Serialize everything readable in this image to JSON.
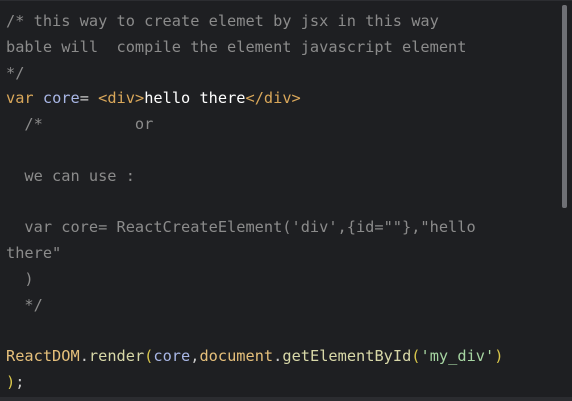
{
  "lines": [
    {
      "segments": [
        {
          "cls": "c-comment",
          "text": "/* this way to create elemet by jsx in this way"
        }
      ]
    },
    {
      "segments": [
        {
          "cls": "c-comment",
          "text": "bable will  compile the element javascript element"
        }
      ]
    },
    {
      "segments": [
        {
          "cls": "c-comment",
          "text": "*/"
        }
      ]
    },
    {
      "segments": [
        {
          "cls": "c-kw",
          "text": "var"
        },
        {
          "cls": "c-plain",
          "text": " "
        },
        {
          "cls": "c-var",
          "text": "core"
        },
        {
          "cls": "c-plain",
          "text": "= "
        },
        {
          "cls": "c-tag",
          "text": "<div>"
        },
        {
          "cls": "c-text",
          "text": "hello there"
        },
        {
          "cls": "c-tag",
          "text": "</div>"
        }
      ]
    },
    {
      "segments": [
        {
          "cls": "c-comment",
          "text": "  /*          or"
        }
      ]
    },
    {
      "segments": [
        {
          "cls": "c-comment",
          "text": ""
        }
      ]
    },
    {
      "segments": [
        {
          "cls": "c-comment",
          "text": "  we can use :"
        }
      ]
    },
    {
      "segments": [
        {
          "cls": "c-comment",
          "text": ""
        }
      ]
    },
    {
      "segments": [
        {
          "cls": "c-comment",
          "text": "  var core= ReactCreateElement('div',{id=\"\"},\"hello"
        }
      ]
    },
    {
      "segments": [
        {
          "cls": "c-comment",
          "text": "there\""
        }
      ]
    },
    {
      "segments": [
        {
          "cls": "c-comment",
          "text": "  )"
        }
      ]
    },
    {
      "segments": [
        {
          "cls": "c-comment",
          "text": "  */"
        }
      ]
    },
    {
      "segments": [
        {
          "cls": "c-plain",
          "text": ""
        }
      ]
    },
    {
      "segments": [
        {
          "cls": "c-obj",
          "text": "ReactDOM"
        },
        {
          "cls": "c-plain",
          "text": "."
        },
        {
          "cls": "c-fn",
          "text": "render"
        },
        {
          "cls": "c-paren",
          "text": "("
        },
        {
          "cls": "c-var",
          "text": "core"
        },
        {
          "cls": "c-plain",
          "text": ","
        },
        {
          "cls": "c-obj",
          "text": "document"
        },
        {
          "cls": "c-plain",
          "text": "."
        },
        {
          "cls": "c-fn",
          "text": "getElementById"
        },
        {
          "cls": "c-paren",
          "text": "("
        },
        {
          "cls": "c-str",
          "text": "'my_div'"
        },
        {
          "cls": "c-paren",
          "text": ")"
        }
      ]
    },
    {
      "segments": [
        {
          "cls": "c-paren",
          "text": ")"
        },
        {
          "cls": "c-plain",
          "text": ";"
        }
      ]
    }
  ]
}
